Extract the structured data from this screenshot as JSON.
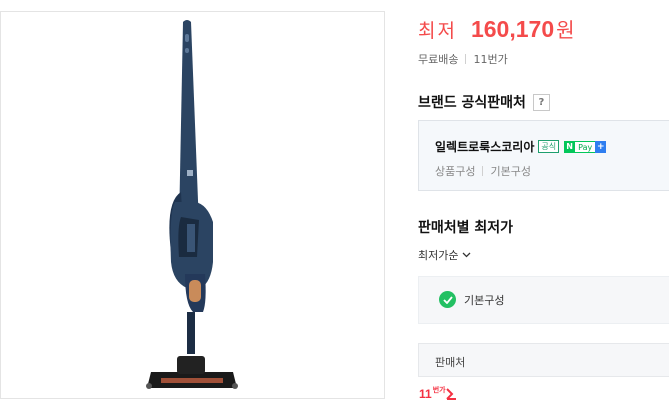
{
  "product": {
    "image_alt": "Electrolux cordless stick vacuum",
    "colors": {
      "body": "#2b4462",
      "accent": "#c98b5a"
    }
  },
  "price": {
    "prefix": "최저",
    "value": "160,170",
    "unit": "원",
    "color": "#f44b4b"
  },
  "meta": {
    "shipping": "무료배송",
    "count": "11번가"
  },
  "brand": {
    "title": "브랜드 공식판매처",
    "help": "?"
  },
  "seller": {
    "name": "일렉트로룩스코리아",
    "badge_official": "공식",
    "npay_n": "N",
    "npay_text": "Pay",
    "npay_plus": "+",
    "sub_1": "상품구성",
    "sub_2": "기본구성"
  },
  "sellers_section": {
    "title": "판매처별 최저가",
    "sort_label": "최저가순"
  },
  "filter": {
    "label": "기본구성"
  },
  "table": {
    "header": "판매처"
  },
  "mall_logo": {
    "number": "11",
    "suffix": "번가"
  }
}
